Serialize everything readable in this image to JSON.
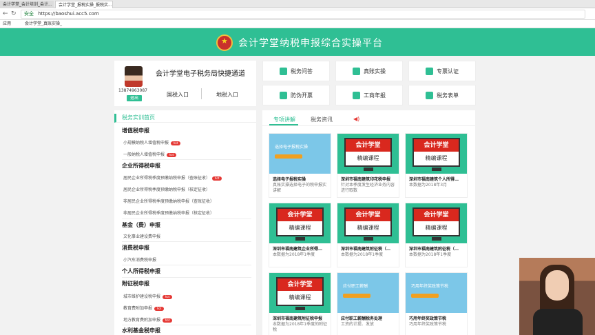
{
  "browser": {
    "tabs": [
      "会计学堂_会计培训_会计...",
      "会计学堂_报税实操_报税实..."
    ],
    "security": "安全",
    "url": "https://baoshui.acc5.com",
    "bookmarks": [
      "应用",
      "会计学堂_真账实操_"
    ]
  },
  "header": {
    "title": "会计学堂纳税申报综合实操平台"
  },
  "profile": {
    "title": "会计学堂电子税务局快捷通道",
    "phone": "13874963087",
    "login": "退出",
    "entries": [
      "国税入口",
      "地税入口"
    ]
  },
  "quick_links": [
    "税务问答",
    "真账实操",
    "专票认证",
    "防伪开票",
    "工商年报",
    "税务表单"
  ],
  "sidebar": {
    "heading": "税务实训首页",
    "groups": [
      {
        "title": "增值税申报",
        "items": [
          {
            "label": "小规模纳税人增值税申报",
            "hot": true
          },
          {
            "label": "一般纳税人增值税申报",
            "hot": true
          }
        ]
      },
      {
        "title": "企业所得税申报",
        "items": [
          {
            "label": "居民企业所得税季度预缴纳税申报（查账征收）",
            "hot": true
          },
          {
            "label": "居民企业所得税季度预缴纳税申报（核定征收）",
            "hot": false
          },
          {
            "label": "非居民企业所得税季度预缴纳税申报（查账征收）",
            "hot": false
          },
          {
            "label": "非居民企业所得税季度预缴纳税申报（核定征收）",
            "hot": false
          }
        ]
      },
      {
        "title": "基金（费）申报",
        "items": [
          {
            "label": "文化事业建设费申报",
            "hot": false
          }
        ]
      },
      {
        "title": "消费税申报",
        "items": [
          {
            "label": "小汽车消费税申报",
            "hot": false
          }
        ]
      },
      {
        "title": "个人所得税申报",
        "items": []
      },
      {
        "title": "附征税申报",
        "items": [
          {
            "label": "城市维护建设税申报",
            "hot": true
          },
          {
            "label": "教育费附加申报",
            "hot": true
          },
          {
            "label": "地方教育费附加申报",
            "hot": true
          }
        ]
      },
      {
        "title": "水利基金税申报",
        "items": []
      }
    ]
  },
  "content": {
    "tabs": [
      "专项讲解",
      "税务资讯"
    ],
    "courses": [
      {
        "thumb": "blue",
        "thumb_text": "选择电子报税实操",
        "title": "选择电子报税实操",
        "desc": "真账实操选择电子的税申报实讲解"
      },
      {
        "thumb": "monitor",
        "title": "深圳市福南建筑印花税申报",
        "desc": "针对本季度发生经济业务内容进行取数"
      },
      {
        "thumb": "monitor",
        "title": "深圳市福南建筑个人所得…",
        "desc": "本数据为2018年3月"
      },
      {
        "thumb": "monitor",
        "title": "深圳市福南建筑企业所得…",
        "desc": "本数据为2018年1季度"
      },
      {
        "thumb": "monitor",
        "title": "深圳市福南建筑附征税（…",
        "desc": "本数据为2018年1季度"
      },
      {
        "thumb": "monitor",
        "title": "深圳市福南建筑附征税（…",
        "desc": "本数据为2018年1季度"
      },
      {
        "thumb": "monitor",
        "title": "深圳市福南建筑附征税申报",
        "desc": "本数据为2018年1季度的附征税"
      },
      {
        "thumb": "blue",
        "thumb_text": "应付职工薪酬",
        "title": "应付职工薪酬税务处理",
        "desc": "工资的计提、发放"
      },
      {
        "thumb": "blue",
        "thumb_text": "巧用年终奖政策节税",
        "title": "巧用年终奖政策节税",
        "desc": "巧用年终奖政策节税"
      }
    ],
    "monitor_top": "会计学堂",
    "monitor_bottom": "精编课程"
  }
}
